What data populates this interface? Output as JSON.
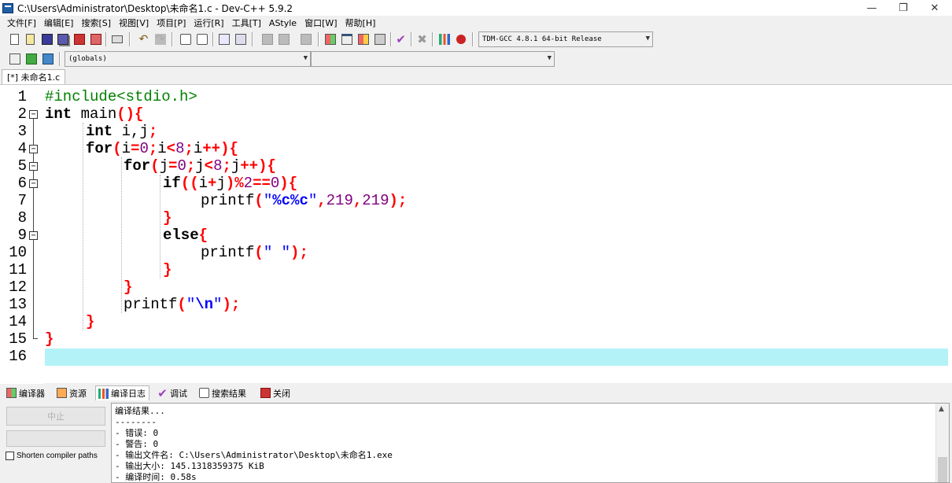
{
  "window": {
    "title": "C:\\Users\\Administrator\\Desktop\\未命名1.c - Dev-C++ 5.9.2",
    "minimize": "—",
    "restore": "❐",
    "close": "✕"
  },
  "menu": [
    "文件[F]",
    "编辑[E]",
    "搜索[S]",
    "视图[V]",
    "项目[P]",
    "运行[R]",
    "工具[T]",
    "AStyle",
    "窗口[W]",
    "帮助[H]"
  ],
  "toolbar": {
    "compiler_select": "TDM-GCC 4.8.1 64-bit Release",
    "scope_select": "(globals)",
    "member_select": ""
  },
  "editor": {
    "tab_label": "[*] 未命名1.c",
    "line_numbers": [
      "1",
      "2",
      "3",
      "4",
      "5",
      "6",
      "7",
      "8",
      "9",
      "10",
      "11",
      "12",
      "13",
      "14",
      "15",
      "16"
    ],
    "code_tokens": {
      "l1_pp": "#include<stdio.h>",
      "int": "int",
      "main": "main",
      "lparen": "(",
      "rparen": ")",
      "lbrace": "{",
      "rbrace": "}",
      "vars": "i,j",
      "semi": ";",
      "for": "for",
      "i": "i",
      "j": "j",
      "eq": "=",
      "zero": "0",
      "lt": "<",
      "eight": "8",
      "inc": "++",
      "if": "if",
      "plus": "+",
      "mod": "%",
      "two": "2",
      "eqeq": "==",
      "printf": "printf",
      "quote": "\"",
      "fmt": "%c%c",
      "comma": ",",
      "n219": "219",
      "else": "else",
      "space_str": "\" \"",
      "nl_esc": "\\n"
    },
    "current_line": 16
  },
  "bottom_tabs": [
    "编译器",
    "资源",
    "编译日志",
    "调试",
    "搜索结果",
    "关闭"
  ],
  "bottom_panel": {
    "stop_button": "中止",
    "shorten_label": "Shorten compiler paths",
    "log_lines": [
      "编译结果...",
      "--------",
      "- 错误: 0",
      "- 警告: 0",
      "- 输出文件名: C:\\Users\\Administrator\\Desktop\\未命名1.exe",
      "- 输出大小: 145.1318359375 KiB",
      "- 编译时间: 0.58s"
    ]
  }
}
